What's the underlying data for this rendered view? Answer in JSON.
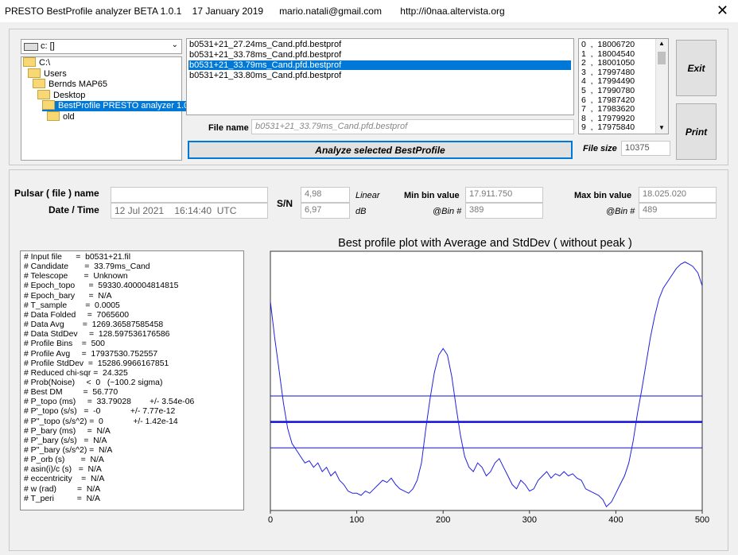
{
  "window": {
    "title": "PRESTO BestProfile analyzer BETA 1.0.1    17 January 2019      mario.natali@gmail.com       http://i0naa.altervista.org"
  },
  "drive": {
    "value": "c: []"
  },
  "tree": [
    {
      "label": "C:\\",
      "indent": 0
    },
    {
      "label": "Users",
      "indent": 1
    },
    {
      "label": "Bernds MAP65",
      "indent": 2
    },
    {
      "label": "Desktop",
      "indent": 3
    },
    {
      "label": "BestProfile PRESTO analyzer 1.0.1.e",
      "indent": 4,
      "selected": true
    },
    {
      "label": "old",
      "indent": 5
    }
  ],
  "files": [
    {
      "label": "b0531+21_27.24ms_Cand.pfd.bestprof"
    },
    {
      "label": "b0531+21_33.78ms_Cand.pfd.bestprof"
    },
    {
      "label": "b0531+21_33.79ms_Cand.pfd.bestprof",
      "selected": true
    },
    {
      "label": "b0531+21_33.80ms_Cand.pfd.bestprof"
    }
  ],
  "bins": [
    "0  ,  18006720",
    "1  ,  18004540",
    "2  ,  18001050",
    "3  ,  17997480",
    "4  ,  17994490",
    "5  ,  17990780",
    "6  ,  17987420",
    "7  ,  17983620",
    "8  ,  17979920",
    "9  ,  17975840"
  ],
  "filename": {
    "label": "File name",
    "value": "b0531+21_33.79ms_Cand.pfd.bestprof"
  },
  "analyze_button": "Analyze selected BestProfile",
  "filesize": {
    "label": "File size",
    "value": "10375"
  },
  "exit_button": "Exit",
  "print_button": "Print",
  "pulsar": {
    "name_label": "Pulsar ( file ) name",
    "date_label": "Date / Time",
    "name_value": "",
    "date_value": "12 Jul 2021    16:14:40  UTC"
  },
  "sn": {
    "label": "S/N",
    "linear": "4,98",
    "linear_label": "Linear",
    "db": "6,97",
    "db_label": "dB"
  },
  "minbin": {
    "label": "Min bin value",
    "value": "17.911.750",
    "at_label": "@Bin #",
    "at_value": "389"
  },
  "maxbin": {
    "label": "Max bin value",
    "value": "18.025.020",
    "at_label": "@Bin #",
    "at_value": "489"
  },
  "stats": [
    "# Input file      =  b0531+21.fil",
    "# Candidate       =  33.79ms_Cand",
    "# Telescope       =  Unknown",
    "# Epoch_topo      =  59330.400004814815",
    "# Epoch_bary      =  N/A",
    "# T_sample        =  0.0005",
    "# Data Folded     =  7065600",
    "# Data Avg        =  1269.36587585458",
    "# Data StdDev     =  128.597536176586",
    "# Profile Bins    =  500",
    "# Profile Avg     =  17937530.752557",
    "# Profile StdDev  =  15286.9966167851",
    "# Reduced chi-sqr =  24.325",
    "# Prob(Noise)     <  0   (~100.2 sigma)",
    "# Best DM         =  56.770",
    "# P_topo (ms)     =  33.79028        +/- 3.54e-06",
    "# P'_topo (s/s)   =  -0             +/- 7.77e-12",
    "# P''_topo (s/s^2) =  0             +/- 1.42e-14",
    "# P_bary (ms)     =  N/A",
    "# P'_bary (s/s)   =  N/A",
    "# P''_bary (s/s^2) =  N/A",
    "# P_orb (s)       =  N/A",
    "# asin(i)/c (s)   =  N/A",
    "# eccentricity    =  N/A",
    "# w (rad)         =  N/A",
    "# T_peri          =  N/A"
  ],
  "chart_data": {
    "type": "line",
    "title": "Best profile plot with  Average and StdDev ( without peak )",
    "xlim": [
      0,
      500
    ],
    "xticks": [
      0,
      100,
      200,
      300,
      400,
      500
    ],
    "ylim": [
      17910000,
      18030000
    ],
    "hlines": [
      17963000,
      17951000,
      17939000
    ],
    "series": [
      {
        "x": [
          0,
          5,
          10,
          15,
          20,
          25,
          30,
          35,
          40,
          45,
          50,
          55,
          60,
          65,
          70,
          75,
          80,
          85,
          90,
          95,
          100,
          105,
          110,
          115,
          120,
          125,
          130,
          135,
          140,
          145,
          150,
          155,
          160,
          165,
          170,
          175,
          180,
          185,
          190,
          195,
          200,
          205,
          210,
          215,
          220,
          225,
          230,
          235,
          240,
          245,
          250,
          255,
          260,
          265,
          270,
          275,
          280,
          285,
          290,
          295,
          300,
          305,
          310,
          315,
          320,
          325,
          330,
          335,
          340,
          345,
          350,
          355,
          360,
          365,
          370,
          375,
          380,
          385,
          389,
          395,
          400,
          405,
          410,
          415,
          420,
          425,
          430,
          435,
          440,
          445,
          450,
          455,
          460,
          465,
          470,
          475,
          480,
          485,
          489,
          495,
          500
        ],
        "y": [
          18006720,
          17990000,
          17975000,
          17960000,
          17948000,
          17941000,
          17938000,
          17935000,
          17932000,
          17933000,
          17930000,
          17932000,
          17928000,
          17930000,
          17926000,
          17928000,
          17924000,
          17922000,
          17919000,
          17918000,
          17918000,
          17917000,
          17919000,
          17918000,
          17920000,
          17922000,
          17924000,
          17923000,
          17925000,
          17922000,
          17920000,
          17919000,
          17918000,
          17920000,
          17924000,
          17932000,
          17948000,
          17962000,
          17974000,
          17982000,
          17985000,
          17982000,
          17972000,
          17958000,
          17945000,
          17935000,
          17930000,
          17928000,
          17932000,
          17930000,
          17926000,
          17928000,
          17932000,
          17934000,
          17930000,
          17926000,
          17922000,
          17920000,
          17924000,
          17922000,
          17919000,
          17920000,
          17924000,
          17926000,
          17928000,
          17925000,
          17927000,
          17926000,
          17928000,
          17926000,
          17927000,
          17925000,
          17924000,
          17920000,
          17919000,
          17918000,
          17917000,
          17915000,
          17911750,
          17914000,
          17918000,
          17922000,
          17926000,
          17932000,
          17942000,
          17955000,
          17966000,
          17978000,
          17990000,
          18000000,
          18008000,
          18013000,
          18016000,
          18019000,
          18022000,
          18024000,
          18025020,
          18024000,
          18023000,
          18020000,
          18014000
        ]
      }
    ]
  }
}
